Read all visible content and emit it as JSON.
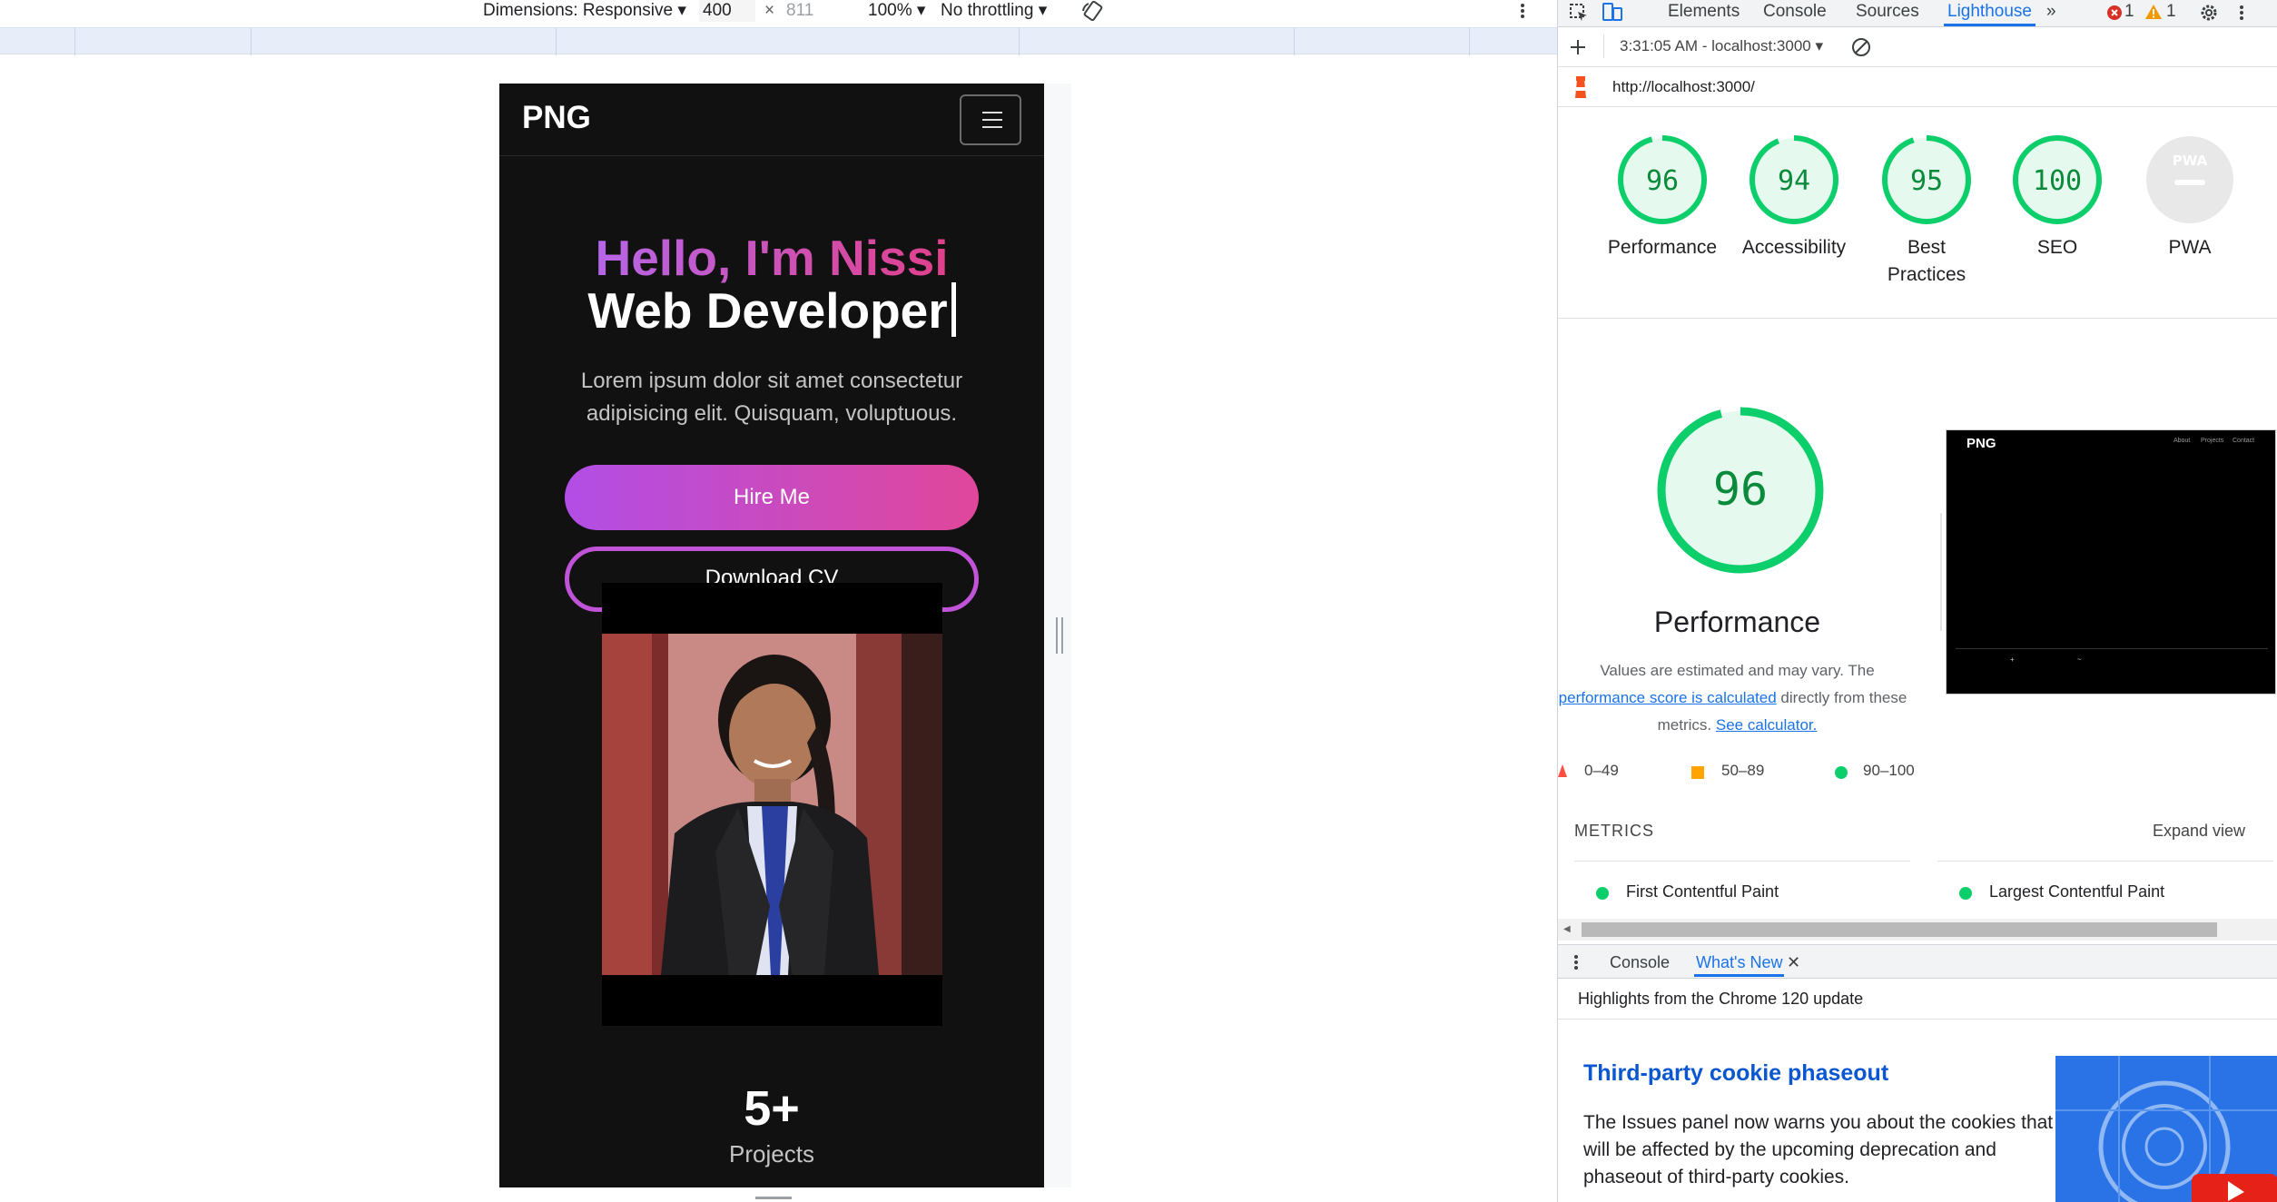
{
  "device_toolbar": {
    "dimensions_label": "Dimensions: Responsive",
    "width_value": "400",
    "times": "×",
    "height_value": "811",
    "zoom": "100%",
    "throttling": "No throttling"
  },
  "site": {
    "brand": "PNG",
    "hello": "Hello, I'm Nissi",
    "role": "Web Developer",
    "description": "Lorem ipsum dolor sit amet consectetur adipisicing elit. Quisquam, voluptuous.",
    "hire_label": "Hire Me",
    "cv_label": "Download CV",
    "stat_number": "5+",
    "stat_label": "Projects"
  },
  "devtools": {
    "tabs": [
      "Elements",
      "Console",
      "Sources",
      "Lighthouse"
    ],
    "active_tab": "Lighthouse",
    "errors": "1",
    "warnings": "1",
    "report_time": "3:31:05 AM - localhost:3000",
    "url": "http://localhost:3000/"
  },
  "lighthouse": {
    "scores": [
      {
        "label": "Performance",
        "value": "96"
      },
      {
        "label": "Accessibility",
        "value": "94"
      },
      {
        "label": "Best Practices",
        "value": "95"
      },
      {
        "label": "SEO",
        "value": "100"
      },
      {
        "label": "PWA",
        "value": ""
      }
    ],
    "pwa_badge": "PWA",
    "perf_score": "96",
    "perf_title": "Performance",
    "note_1": "Values are estimated and may vary. The",
    "note_link": "performance score is calculated",
    "note_2": "directly from these",
    "note_3": "metrics.",
    "note_link2": "See calculator.",
    "legend": [
      "0–49",
      "50–89",
      "90–100"
    ],
    "metrics_heading": "METRICS",
    "expand_label": "Expand view",
    "metric_1": "First Contentful Paint",
    "metric_2": "Largest Contentful Paint",
    "thumb_brand": "PNG",
    "thumb_nav": [
      "About",
      "Projects",
      "Contact"
    ]
  },
  "drawer": {
    "tabs": [
      "Console",
      "What's New"
    ],
    "active_tab": "What's New",
    "highlights": "Highlights from the Chrome 120 update",
    "news_title": "Third-party cookie phaseout",
    "news_body": "The Issues panel now warns you about the cookies that will be affected by the upcoming deprecation and phaseout of third-party cookies."
  },
  "colors": {
    "pass": "#0cce6b",
    "average": "#ffa400",
    "fail": "#ff4e42",
    "accent": "#1a73e8",
    "gradient_start": "#b666e8",
    "gradient_end": "#e0408a"
  }
}
